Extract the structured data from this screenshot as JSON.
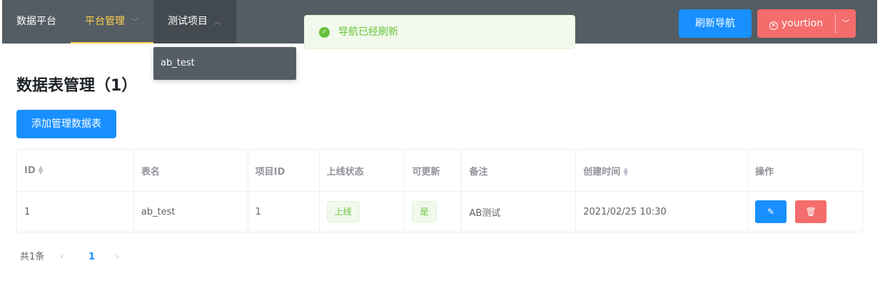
{
  "nav": {
    "brand": "数据平台",
    "items": [
      {
        "label": "平台管理"
      },
      {
        "label": "测试项目"
      }
    ],
    "dropdown_item": "ab_test"
  },
  "header_actions": {
    "refresh_label": "刷新导航",
    "user_label": "yourtion"
  },
  "toast": {
    "message": "导航已经刷新"
  },
  "page": {
    "title": "数据表管理（1）",
    "add_button": "添加管理数据表"
  },
  "table": {
    "columns": [
      "ID",
      "表名",
      "项目ID",
      "上线状态",
      "可更新",
      "备注",
      "创建时间",
      "操作"
    ],
    "rows": [
      {
        "id": "1",
        "name": "ab_test",
        "project_id": "1",
        "online_status": "上线",
        "updatable": "是",
        "remark": "AB测试",
        "created_at": "2021/02/25 10:30"
      }
    ]
  },
  "pagination": {
    "total_text": "共1条",
    "current_page": "1"
  },
  "colors": {
    "nav_bg": "#545c64",
    "nav_active": "#ffd04b",
    "primary": "#1890ff",
    "danger": "#f56c6c",
    "success": "#67c23a"
  }
}
